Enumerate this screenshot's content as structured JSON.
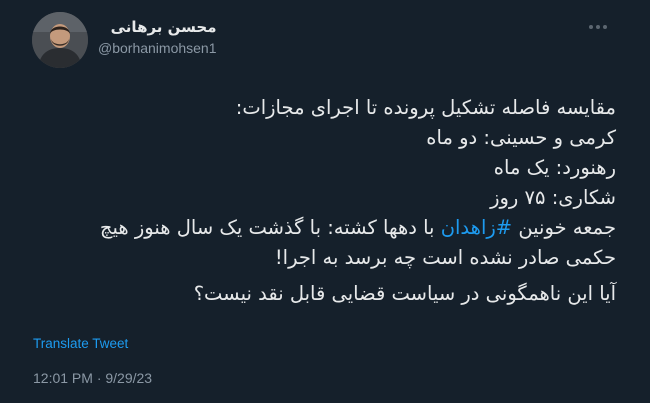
{
  "author": {
    "display_name": "محسن برهانی",
    "handle": "@borhanimohsen1"
  },
  "tweet": {
    "line1": "مقایسه فاصله تشکیل پرونده تا اجرای مجازات:",
    "line2": "کرمی و حسینی: دو ماه",
    "line3": "رهنورد: یک ماه",
    "line4": "شکاری: ۷۵ روز",
    "line5_before": "جمعه خونین ",
    "line5_hashtag": "#زاهدان",
    "line5_after": " با دهها کشته: با گذشت یک سال هنوز هیچ",
    "line6": "حکمی صادر نشده است چه برسد به اجرا!",
    "line7": "آیا این ناهمگونی در سیاست قضایی قابل نقد نیست؟"
  },
  "translate_label": "Translate Tweet",
  "timestamp": "12:01 PM · 9/29/23",
  "icons": {
    "more": "more-options-icon",
    "avatar": "profile-photo"
  },
  "colors": {
    "background": "#15202b",
    "text": "#e7e9ea",
    "muted": "#8b98a5",
    "accent": "#1d9bf0"
  }
}
